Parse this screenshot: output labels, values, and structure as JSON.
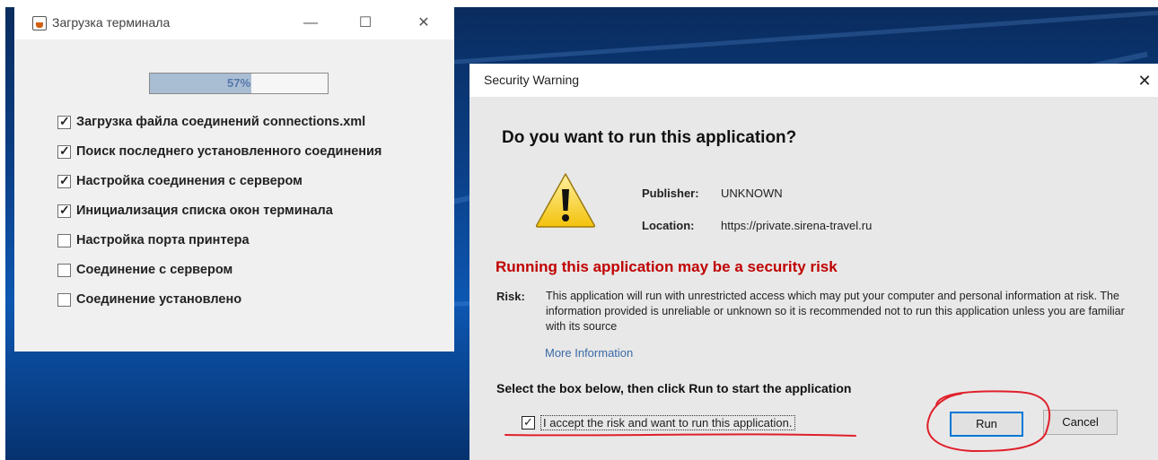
{
  "loader_window": {
    "title": "Загрузка терминала",
    "progress": {
      "percent_text": "57%",
      "value": 0.57
    },
    "tasks": [
      {
        "label": "Загрузка файла соединений connections.xml",
        "checked": true
      },
      {
        "label": "Поиск последнего установленного соединения",
        "checked": true
      },
      {
        "label": "Настройка соединения с сервером",
        "checked": true
      },
      {
        "label": "Инициализация списка окон терминала",
        "checked": true
      },
      {
        "label": "Настройка порта принтера",
        "checked": false
      },
      {
        "label": "Соединение с сервером",
        "checked": false
      },
      {
        "label": "Соединение установлено",
        "checked": false
      }
    ]
  },
  "security_dialog": {
    "title": "Security Warning",
    "headline": "Do you want to run this application?",
    "publisher_label": "Publisher:",
    "publisher_value": "UNKNOWN",
    "location_label": "Location:",
    "location_value": "https://private.sirena-travel.ru",
    "risk_headline": "Running this application may be a security risk",
    "risk_label": "Risk:",
    "risk_text": "This application will run with unrestricted access which may put your computer and personal information at risk. The information provided is unreliable or unknown so it is recommended not to run this application unless you are familiar with its source",
    "more_info": "More Information",
    "select_instruction": "Select the box below, then click Run to start the application",
    "accept_label": "I accept the risk and want to run this application.",
    "accept_checked": true,
    "run_label": "Run",
    "cancel_label": "Cancel"
  },
  "colors": {
    "risk_red": "#c00000",
    "link_blue": "#3b6aa6",
    "focus_blue": "#0078d7",
    "annotation_red": "#e0202a"
  }
}
